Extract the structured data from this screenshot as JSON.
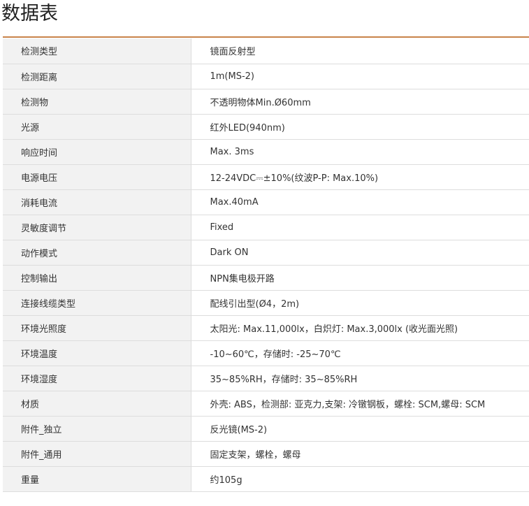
{
  "title": "数据表",
  "rows": [
    {
      "label": "检测类型",
      "value": "镜面反射型"
    },
    {
      "label": "检测距离",
      "value": "1m(MS-2)"
    },
    {
      "label": "检测物",
      "value": "不透明物体Min.Ø60mm"
    },
    {
      "label": "光源",
      "value": "红外LED(940nm)"
    },
    {
      "label": "响应时间",
      "value": "Max. 3ms"
    },
    {
      "label": "电源电压",
      "value": "12-24VDC⎓±10%(纹波P-P: Max.10%)"
    },
    {
      "label": "消耗电流",
      "value": "Max.40mA"
    },
    {
      "label": "灵敏度调节",
      "value": "Fixed"
    },
    {
      "label": "动作模式",
      "value": "Dark ON"
    },
    {
      "label": "控制输出",
      "value": "NPN集电极开路"
    },
    {
      "label": "连接线缆类型",
      "value": "配线引出型(Ø4，2m)"
    },
    {
      "label": "环境光照度",
      "value": "太阳光: Max.11,000lx，白炽灯: Max.3,000lx (收光面光照)"
    },
    {
      "label": "环境温度",
      "value": "-10~60℃，存储时: -25~70℃"
    },
    {
      "label": "环境湿度",
      "value": "35~85%RH，存储时: 35~85%RH"
    },
    {
      "label": "材质",
      "value": "外壳: ABS，检测部: 亚克力,支架: 冷镦钢板，螺栓: SCM,螺母: SCM"
    },
    {
      "label": "附件_独立",
      "value": "反光镜(MS-2)"
    },
    {
      "label": "附件_通用",
      "value": "固定支架，螺栓，螺母"
    },
    {
      "label": "重量",
      "value": "约105g"
    }
  ],
  "colors": {
    "accent_rule": "#c9834a",
    "label_bg": "#f2f2f2",
    "border": "#dddddd"
  }
}
